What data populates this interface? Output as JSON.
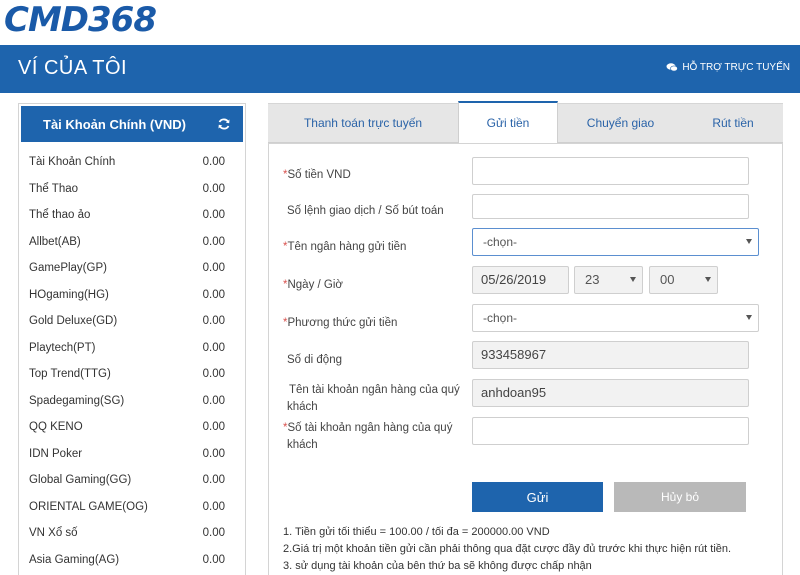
{
  "brand": {
    "logo": "CMD368"
  },
  "header": {
    "title": "VÍ CỦA TÔI",
    "support_label": "HỖ TRỢ TRỰC TUYẾN",
    "color": "#1e64ad"
  },
  "sidebar": {
    "title": "Tài Khoản Chính (VND)",
    "refresh_icon": "refresh-icon",
    "accounts": [
      {
        "name": "Tài Khoản Chính",
        "balance": "0.00"
      },
      {
        "name": "Thể Thao",
        "balance": "0.00"
      },
      {
        "name": "Thể thao ảo",
        "balance": "0.00"
      },
      {
        "name": "Allbet(AB)",
        "balance": "0.00"
      },
      {
        "name": "GamePlay(GP)",
        "balance": "0.00"
      },
      {
        "name": "HOgaming(HG)",
        "balance": "0.00"
      },
      {
        "name": "Gold Deluxe(GD)",
        "balance": "0.00"
      },
      {
        "name": "Playtech(PT)",
        "balance": "0.00"
      },
      {
        "name": "Top Trend(TTG)",
        "balance": "0.00"
      },
      {
        "name": "Spadegaming(SG)",
        "balance": "0.00"
      },
      {
        "name": "QQ KENO",
        "balance": "0.00"
      },
      {
        "name": "IDN Poker",
        "balance": "0.00"
      },
      {
        "name": "Global Gaming(GG)",
        "balance": "0.00"
      },
      {
        "name": "ORIENTAL GAME(OG)",
        "balance": "0.00"
      },
      {
        "name": "VN Xổ số",
        "balance": "0.00"
      },
      {
        "name": "Asia Gaming(AG)",
        "balance": "0.00"
      }
    ]
  },
  "tabs": [
    {
      "label": "Thanh toán trực tuyến"
    },
    {
      "label": "Gửi tiền",
      "active": true
    },
    {
      "label": "Chuyển giao"
    },
    {
      "label": "Rút tiền"
    }
  ],
  "form": {
    "amount_label": "Số tiền VND",
    "amount_value": "",
    "ref_label": "Số lệnh giao dịch / Số bút toán",
    "ref_value": "",
    "bank_label": "Tên ngân hàng gửi tiền",
    "bank_value": "-chọn-",
    "datetime_label": "Ngày / Giờ",
    "date_value": "05/26/2019",
    "hour_value": "23",
    "minute_value": "00",
    "method_label": "Phương thức gửi tiền",
    "method_value": "-chọn-",
    "mobile_label": "Số di động",
    "mobile_value": "933458967",
    "acc_name_label_1": "Tên tài khoản ngân hàng của quý",
    "acc_name_label_2": "khách",
    "acc_name_value": "anhdoan95",
    "acc_no_label_1": "Số tài khoản ngân hàng của quý",
    "acc_no_label_2": "khách",
    "acc_no_value": "",
    "required_mark": "*",
    "submit_label": "Gửi",
    "cancel_label": "Hủy bỏ"
  },
  "notes": [
    "1. Tiền gửi tối thiểu = 100.00 / tối đa = 200000.00 VND",
    "2.Giá trị một khoản tiền gửi cần phải thông qua đặt cược đầy đủ trước khi thực hiện rút tiền.",
    "3. sử dụng tài khoản của bên thứ ba sẽ không được chấp nhận"
  ]
}
